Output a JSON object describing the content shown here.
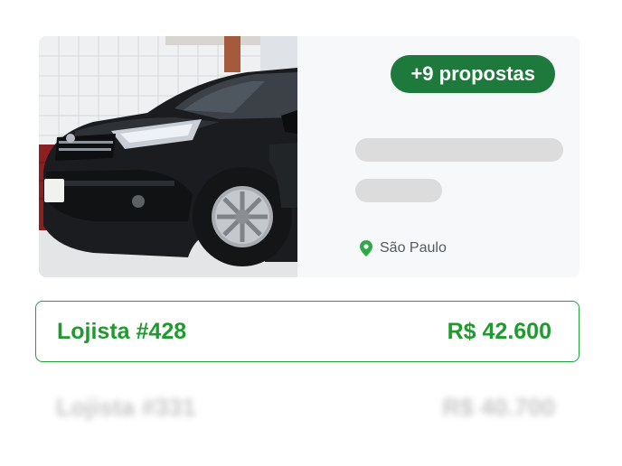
{
  "listing": {
    "proposals_badge": "+9 propostas",
    "location": "São Paulo",
    "photo_icon": "car-photo",
    "location_icon": "map-pin-icon"
  },
  "offers": [
    {
      "store": "Lojista #428",
      "price": "R$ 42.600"
    },
    {
      "store": "Lojista #331",
      "price": "R$ 40.700"
    }
  ],
  "colors": {
    "badge_bg": "#1e7a3c",
    "accent_green": "#1f9a2e",
    "border_green": "#22a33a",
    "skeleton": "#dcdcdc"
  }
}
